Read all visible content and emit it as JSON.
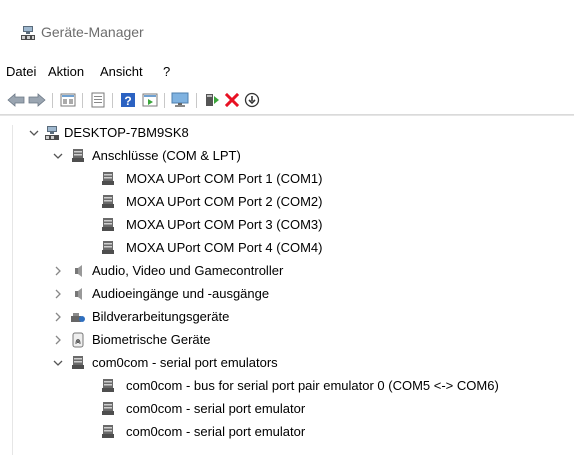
{
  "window": {
    "title": "Geräte-Manager"
  },
  "menu": [
    "Datei",
    "Aktion",
    "Ansicht",
    "?"
  ],
  "toolbar": {
    "buttons": [
      "back-icon",
      "forward-icon",
      "properties-icon",
      "update-list-icon",
      "help-icon",
      "show-hidden-icon",
      "monitor-icon",
      "add-driver-icon",
      "uninstall-icon",
      "download-icon"
    ]
  },
  "tree": {
    "root": "DESKTOP-7BM9SK8",
    "ports": {
      "label": "Anschlüsse (COM & LPT)",
      "children": [
        "MOXA UPort COM Port 1 (COM1)",
        "MOXA UPort COM Port 2 (COM2)",
        "MOXA UPort COM Port 3 (COM3)",
        "MOXA UPort COM Port 4 (COM4)"
      ]
    },
    "audio_video": "Audio, Video und Gamecontroller",
    "audio_io": "Audioeingänge und -ausgänge",
    "imaging": "Bildverarbeitungsgeräte",
    "biometric": "Biometrische Geräte",
    "com0com": {
      "label": "com0com - serial port emulators",
      "children": [
        "com0com - bus for serial port pair emulator 0 (COM5 <-> COM6)",
        "com0com - serial port emulator",
        "com0com - serial port emulator"
      ]
    }
  },
  "colors": {
    "accent": "#0078d7",
    "delete": "#e81123",
    "green": "#3aa63a"
  }
}
